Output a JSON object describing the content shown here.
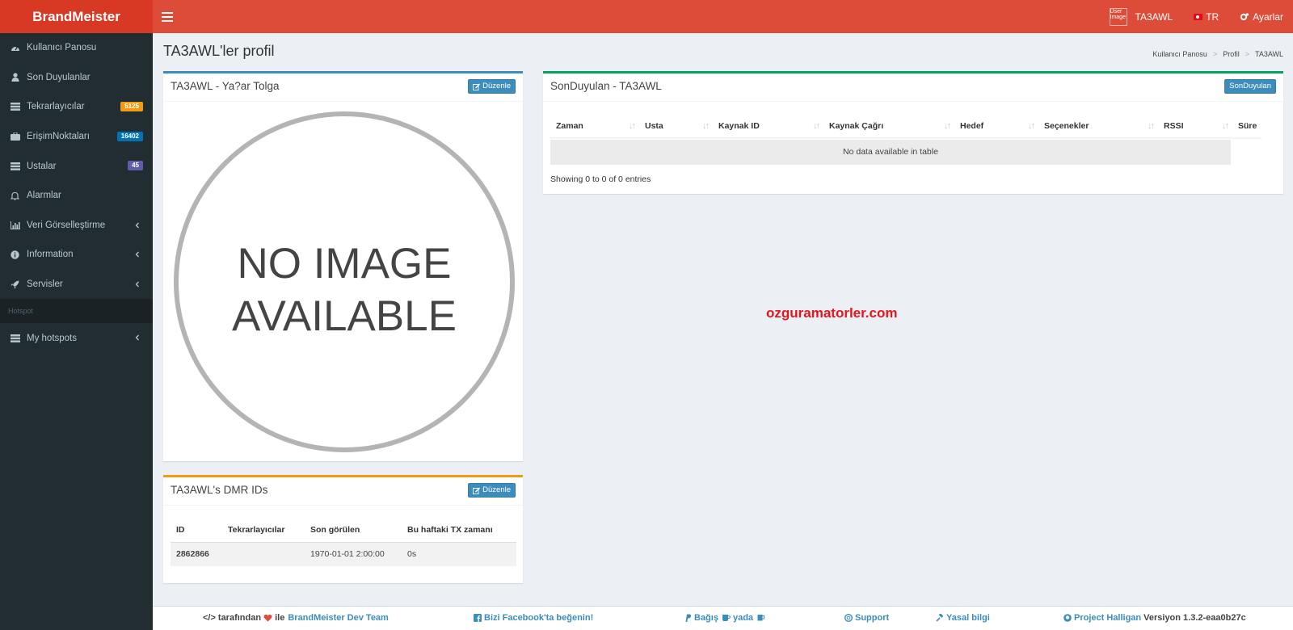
{
  "header": {
    "logo": "BrandMeister",
    "user_image_alt": "User Image",
    "username": "TA3AWL",
    "language": "TR",
    "settings": "Ayarlar"
  },
  "sidebar": {
    "items": [
      {
        "label": "Kullanıcı Panosu",
        "icon": "dashboard-icon"
      },
      {
        "label": "Son Duyulanlar",
        "icon": "user-icon"
      },
      {
        "label": "Tekrarlayıcılar",
        "icon": "server-icon",
        "badge": "5125",
        "badge_color": "#f39c12"
      },
      {
        "label": "ErişimNoktaları",
        "icon": "briefcase-icon",
        "badge": "16402",
        "badge_color": "#0073b7"
      },
      {
        "label": "Ustalar",
        "icon": "server-icon",
        "badge": "45",
        "badge_color": "#605ca8"
      },
      {
        "label": "Alarmlar",
        "icon": "bell-icon"
      },
      {
        "label": "Veri Görselleştirme",
        "icon": "bar-chart-icon"
      },
      {
        "label": "Information",
        "icon": "info-icon"
      },
      {
        "label": "Servisler",
        "icon": "rocket-icon"
      }
    ],
    "section_header": "Hotspot",
    "hotspot_item": {
      "label": "My hotspots",
      "icon": "server-icon"
    }
  },
  "page": {
    "title": "TA3AWL'ler profil",
    "breadcrumb": [
      "Kullanıcı Panosu",
      "Profil",
      "TA3AWL"
    ]
  },
  "profile_box": {
    "title": "TA3AWL - Ya?ar Tolga",
    "edit_label": "Düzenle",
    "image_text_line1": "NO IMAGE",
    "image_text_line2": "AVAILABLE"
  },
  "dmr_box": {
    "title": "TA3AWL's DMR IDs",
    "edit_label": "Düzenle",
    "columns": [
      "ID",
      "Tekrarlayıcılar",
      "Son görülen",
      "Bu haftaki TX zamanı"
    ],
    "rows": [
      {
        "id": "2862866",
        "repeaters": "",
        "last_seen": "1970-01-01 2:00:00",
        "tx_time": "0s"
      }
    ]
  },
  "lastheard_box": {
    "title": "SonDuyulan - TA3AWL",
    "button_label": "SonDuyulan",
    "columns": [
      "Zaman",
      "Usta",
      "Kaynak ID",
      "Kaynak Çağrı",
      "Hedef",
      "Seçenekler",
      "RSSI",
      "Süre"
    ],
    "empty_message": "No data available in table",
    "info": "Showing 0 to 0 of 0 entries"
  },
  "watermark": "ozguramatorler.com",
  "footer": {
    "by_text": "tarafından",
    "with_text": "ile",
    "team": "BrandMeister Dev Team",
    "facebook": "Bizi Facebook'ta beğenin!",
    "donate": "Bağış",
    "or_text": "yada",
    "support": "Support",
    "legal": "Yasal bilgi",
    "project": "Project Halligan",
    "version": "Versiyon 1.3.2-eaa0b27c"
  },
  "colors": {
    "header": "#dd4b39",
    "logo_bg": "#d73925",
    "sidebar": "#222d32",
    "primary": "#3c8dbc",
    "success": "#00a65a",
    "warning": "#f39c12"
  }
}
